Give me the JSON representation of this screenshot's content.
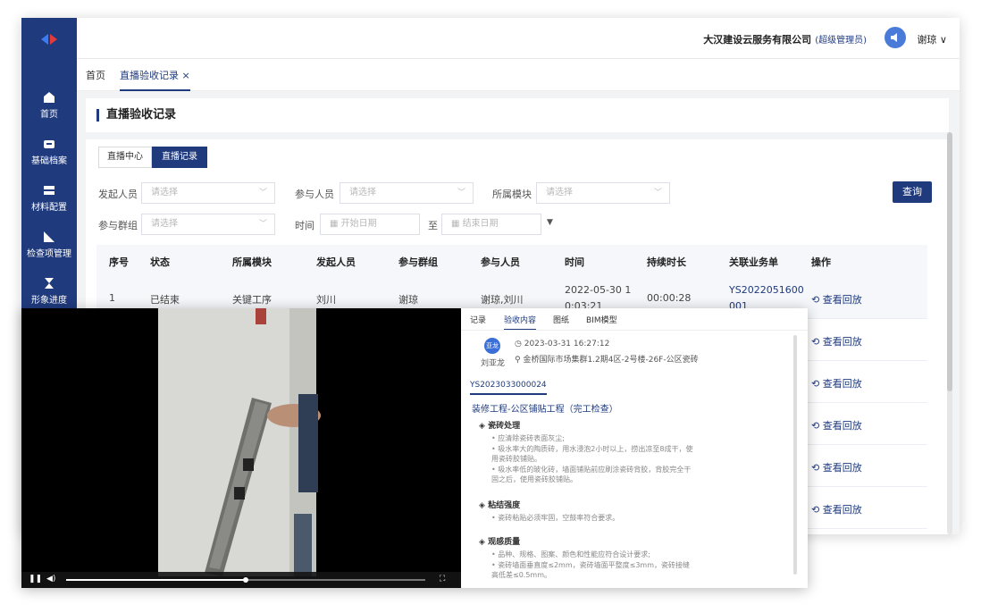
{
  "sidebar": {
    "items": [
      {
        "label": "首页",
        "icon": "home-icon"
      },
      {
        "label": "基础档案",
        "icon": "archive-icon"
      },
      {
        "label": "材料配置",
        "icon": "material-icon"
      },
      {
        "label": "检查项管理",
        "icon": "ruler-icon"
      },
      {
        "label": "形象进度",
        "icon": "hourglass-icon"
      }
    ]
  },
  "topbar": {
    "company": "大汉建设云服务有限公司",
    "role": "(超级管理员)",
    "user": "谢琼 ∨"
  },
  "tabs": [
    {
      "label": "首页"
    },
    {
      "label": "直播验收记录 ×"
    }
  ],
  "page": {
    "title": "直播验收记录",
    "segments": [
      "直播中心",
      "直播记录"
    ]
  },
  "filters": {
    "initiator_label": "发起人员",
    "initiator_placeholder": "请选择",
    "participant_label": "参与人员",
    "participant_placeholder": "请选择",
    "module_label": "所属模块",
    "module_placeholder": "请选择",
    "group_label": "参与群组",
    "group_placeholder": "请选择",
    "time_label": "时间",
    "start_placeholder": "开始日期",
    "to_label": "至",
    "end_placeholder": "结束日期",
    "query_button": "查询"
  },
  "table": {
    "headers": [
      "序号",
      "状态",
      "所属模块",
      "发起人员",
      "参与群组",
      "参与人员",
      "时间",
      "持续时长",
      "关联业务单",
      "操作"
    ],
    "row1": {
      "index": "1",
      "status": "已结束",
      "module": "关键工序",
      "initiator": "刘川",
      "group": "谢琼",
      "participants": "谢琼,刘川",
      "time_line1": "2022-05-30 1",
      "time_line2": "0:03:21",
      "duration": "00:00:28",
      "biz_line1": "YS2022051600",
      "biz_line2": "001"
    },
    "action_label": "查看回放",
    "action_count": 6
  },
  "video": {
    "progress_fraction": 0.5
  },
  "panel": {
    "tabs": [
      "记录",
      "验收内容",
      "图纸",
      "BIM模型"
    ],
    "active_tab": "验收内容",
    "record": {
      "avatar_text": "亚龙",
      "name": "刘亚龙",
      "timestamp": "2023-03-31 16:27:12",
      "location": "金桥国际市场集群1.2期4区-2号楼-26F-公区瓷砖"
    },
    "biz_no": "YS2023033000024",
    "project": "装修工程-公区铺贴工程（完工检查）",
    "sections": [
      {
        "title": "瓷砖处理",
        "items": [
          "应清除瓷砖表面灰尘;",
          "吸水率大的陶质砖，用水浸泡2小时以上，捞出凉至8成干，使用瓷砖胶铺贴。",
          "吸水率低的玻化砖，墙面铺贴前应刷涂瓷砖背胶，背胶完全干固之后，使用瓷砖胶铺贴。"
        ]
      },
      {
        "title": "粘结强度",
        "items": [
          "瓷砖粘贴必须牢固，空鼓率符合要求。"
        ]
      },
      {
        "title": "观感质量",
        "items": [
          "品种、规格、图案、颜色和性能应符合设计要求;",
          "瓷砖墙面垂直度≤2mm，瓷砖墙面平整度≤3mm，瓷砖接缝高低差≤0.5mm。"
        ]
      }
    ]
  },
  "colors": {
    "sidebar": "#1f3a7d",
    "accent": "#1f3a7d",
    "avatar": "#4a7bd8"
  }
}
